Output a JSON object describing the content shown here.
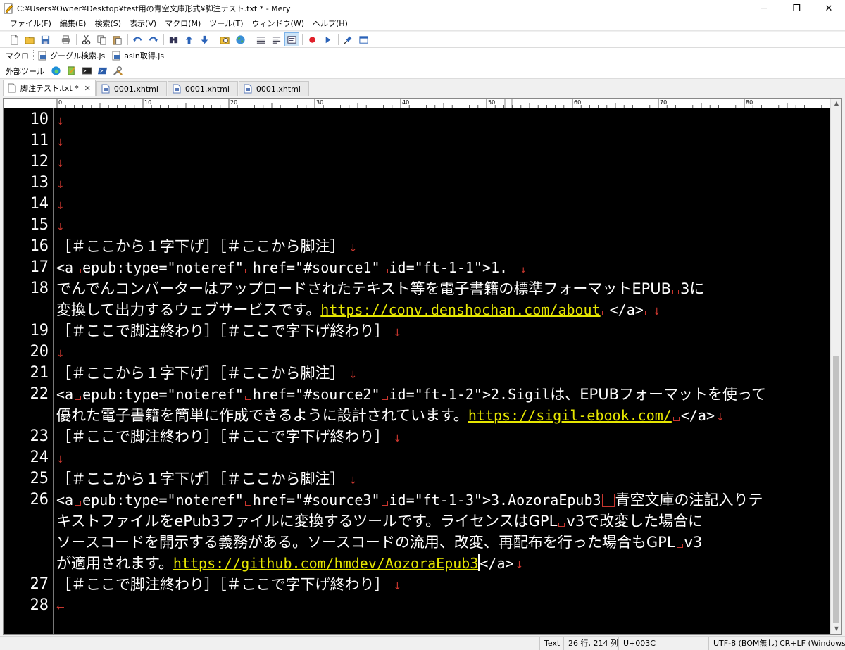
{
  "window": {
    "title": "C:¥Users¥Owner¥Desktop¥test用の青空文庫形式¥脚注テスト.txt * - Mery",
    "minimize": "─",
    "maximize": "❐",
    "close": "✕"
  },
  "menu": [
    "ファイル(F)",
    "編集(E)",
    "検索(S)",
    "表示(V)",
    "マクロ(M)",
    "ツール(T)",
    "ウィンドウ(W)",
    "ヘルプ(H)"
  ],
  "macrobar": {
    "label": "マクロ",
    "items": [
      "グーグル検索.js",
      "asin取得.js"
    ]
  },
  "extbar": {
    "label": "外部ツール"
  },
  "tabs": [
    {
      "label": "脚注テスト.txt *",
      "close": "✕"
    },
    {
      "label": "0001.xhtml"
    },
    {
      "label": "0001.xhtml"
    },
    {
      "label": "0001.xhtml"
    }
  ],
  "ruler": [
    "0",
    "10",
    "20",
    "30",
    "40",
    "50",
    "60",
    "70",
    "80"
  ],
  "lines": {
    "l10": {
      "num": "10"
    },
    "l11": {
      "num": "11"
    },
    "l12": {
      "num": "12"
    },
    "l13": {
      "num": "13"
    },
    "l14": {
      "num": "14"
    },
    "l15": {
      "num": "15"
    },
    "l16": {
      "num": "16",
      "text": "［＃ここから１字下げ］［＃ここから脚注］"
    },
    "l17": {
      "num": "17",
      "a1": "<a",
      "a2": "epub:type=\"noteref\"",
      "a3": "href=\"#source1\"",
      "a4": "id=\"ft-1-1\">1."
    },
    "l18": {
      "num": "18",
      "text": "でんでんコンバーターはアップロードされたテキスト等を電子書籍の標準フォーマットEPUB",
      "tail": "3に"
    },
    "l18b": {
      "text": "変換して出力するウェブサービスです。",
      "url": "https://conv.denshochan.com/about",
      "end": "</a>"
    },
    "l19": {
      "num": "19",
      "text": "［＃ここで脚注終わり］［＃ここで字下げ終わり］"
    },
    "l20": {
      "num": "20"
    },
    "l21": {
      "num": "21",
      "text": "［＃ここから１字下げ］［＃ここから脚注］"
    },
    "l22": {
      "num": "22",
      "a1": "<a",
      "a2": "epub:type=\"noteref\"",
      "a3": "href=\"#source2\"",
      "a4": "id=\"ft-1-2\">2.Sigil",
      "rest": "は、EPUBフォーマットを使って"
    },
    "l22b": {
      "text": "優れた電子書籍を簡単に作成できるように設計されています。",
      "url": "https://sigil-ebook.com/",
      "end": "</a>"
    },
    "l23": {
      "num": "23",
      "text": "［＃ここで脚注終わり］［＃ここで字下げ終わり］"
    },
    "l24": {
      "num": "24"
    },
    "l25": {
      "num": "25",
      "text": "［＃ここから１字下げ］［＃ここから脚注］"
    },
    "l26": {
      "num": "26",
      "a1": "<a",
      "a2": "epub:type=\"noteref\"",
      "a3": "href=\"#source3\"",
      "a4": "id=\"ft-1-3\">3.AozoraEpub3",
      "rest": "青空文庫の注記入りテ"
    },
    "l26b": {
      "text": "キストファイルをePub3ファイルに変換するツールです。ライセンスはGPL",
      "tail": "v3で改変した場合に"
    },
    "l26c": {
      "text": "ソースコードを開示する義務がある。ソースコードの流用、改変、再配布を行った場合もGPL",
      "tail": "v3"
    },
    "l26d": {
      "text": "が適用されます。",
      "url": "https://github.com/hmdev/AozoraEpub3",
      "end": "</a>"
    },
    "l27": {
      "num": "27",
      "text": "［＃ここで脚注終わり］［＃ここで字下げ終わり］"
    },
    "l28": {
      "num": "28"
    }
  },
  "eol_symbol": "↓",
  "eof_symbol": "←",
  "status": {
    "mode": "Text",
    "position": "26 行, 214 列",
    "codepoint": "U+003C",
    "encoding": "UTF-8 (BOM無し)",
    "newline": "CR+LF (Windows)"
  },
  "colors": {
    "editor_bg": "#000000",
    "text": "#ffffff",
    "url": "#e6e600",
    "control_marks": "#c8362e"
  }
}
